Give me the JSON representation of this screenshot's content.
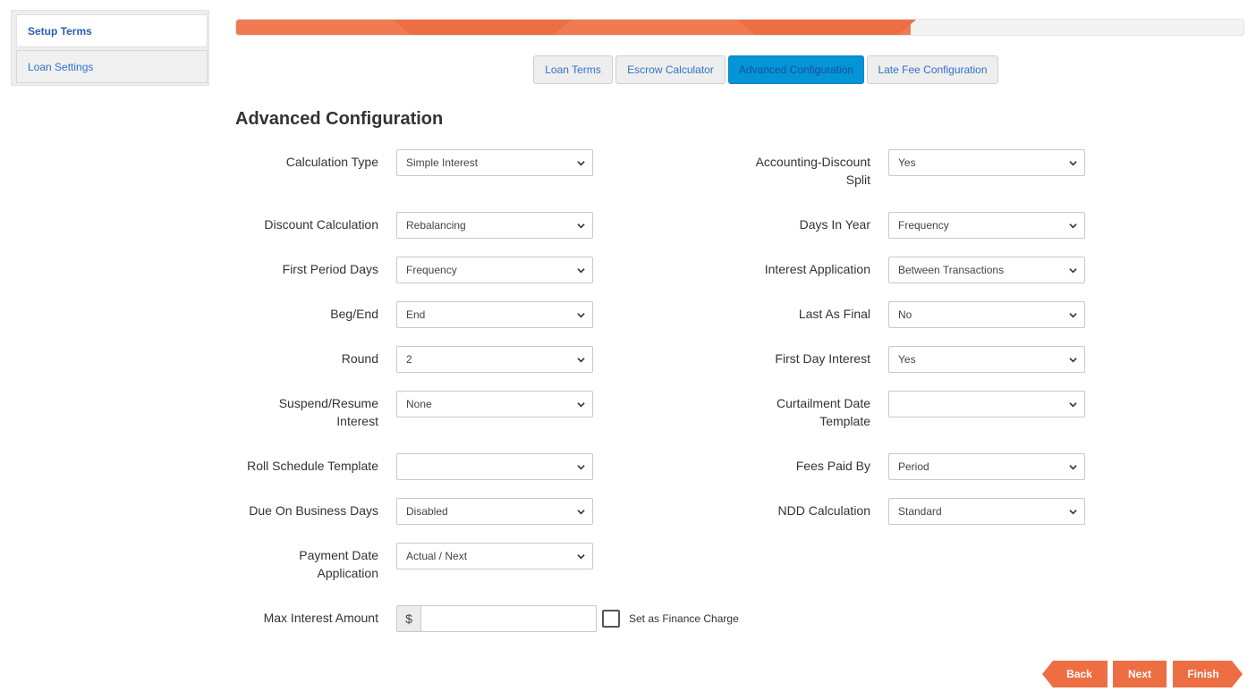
{
  "sidebar": {
    "items": [
      {
        "label": "Setup Terms"
      },
      {
        "label": "Loan Settings"
      }
    ]
  },
  "progress": {
    "percent": 67
  },
  "tabs": [
    {
      "label": "Loan Terms"
    },
    {
      "label": "Escrow Calculator"
    },
    {
      "label": "Advanced Configuration"
    },
    {
      "label": "Late Fee Configuration"
    }
  ],
  "page_title": "Advanced Configuration",
  "left_fields": [
    {
      "label": "Calculation Type",
      "value": "Simple Interest"
    },
    {
      "label": "Discount Calculation",
      "value": "Rebalancing"
    },
    {
      "label": "First Period Days",
      "value": "Frequency"
    },
    {
      "label": "Beg/End",
      "value": "End"
    },
    {
      "label": "Round",
      "value": "2"
    },
    {
      "label": "Suspend/Resume Interest",
      "value": "None"
    },
    {
      "label": "Roll Schedule Template",
      "value": ""
    },
    {
      "label": "Due On Business Days",
      "value": "Disabled"
    },
    {
      "label": "Payment Date Application",
      "value": "Actual / Next"
    }
  ],
  "right_fields": [
    {
      "label": "Accounting-Discount Split",
      "value": "Yes"
    },
    {
      "label": "Days In Year",
      "value": "Frequency"
    },
    {
      "label": "Interest Application",
      "value": "Between Transactions"
    },
    {
      "label": "Last As Final",
      "value": "No"
    },
    {
      "label": "First Day Interest",
      "value": "Yes"
    },
    {
      "label": "Curtailment Date Template",
      "value": ""
    },
    {
      "label": "Fees Paid By",
      "value": "Period"
    },
    {
      "label": "NDD Calculation",
      "value": "Standard"
    }
  ],
  "max_interest": {
    "label": "Max Interest Amount",
    "currency": "$",
    "value": "",
    "checkbox_label": "Set as Finance Charge"
  },
  "buttons": {
    "back": "Back",
    "next": "Next",
    "finish": "Finish"
  },
  "colors": {
    "accent": "#ee6e44",
    "active_tab": "#0395d6",
    "link": "#2f73c9"
  }
}
